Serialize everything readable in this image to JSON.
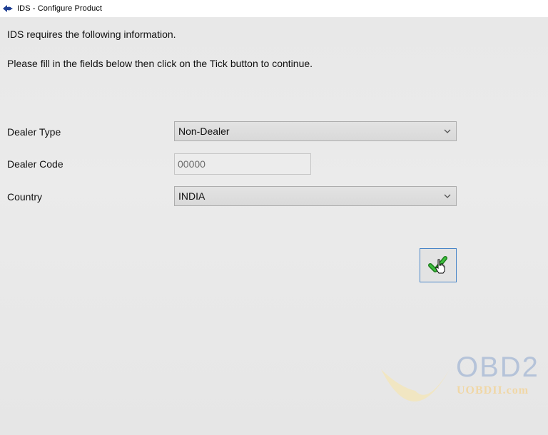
{
  "window": {
    "title": "IDS - Configure Product"
  },
  "intro": {
    "line1": "IDS requires the following information.",
    "line2": "Please fill in the fields below then click on the Tick button to continue."
  },
  "form": {
    "dealer_type": {
      "label": "Dealer Type",
      "value": "Non-Dealer"
    },
    "dealer_code": {
      "label": "Dealer Code",
      "value": "00000"
    },
    "country": {
      "label": "Country",
      "value": "INDIA"
    }
  },
  "tick_button": {
    "icon": "checkmark-icon",
    "color": "#2e9a2e"
  },
  "watermark": {
    "brand": "OBD2",
    "site": "UOBDII.com"
  },
  "colors": {
    "accent_border": "#4a86c8",
    "background": "#e9e9e9"
  }
}
